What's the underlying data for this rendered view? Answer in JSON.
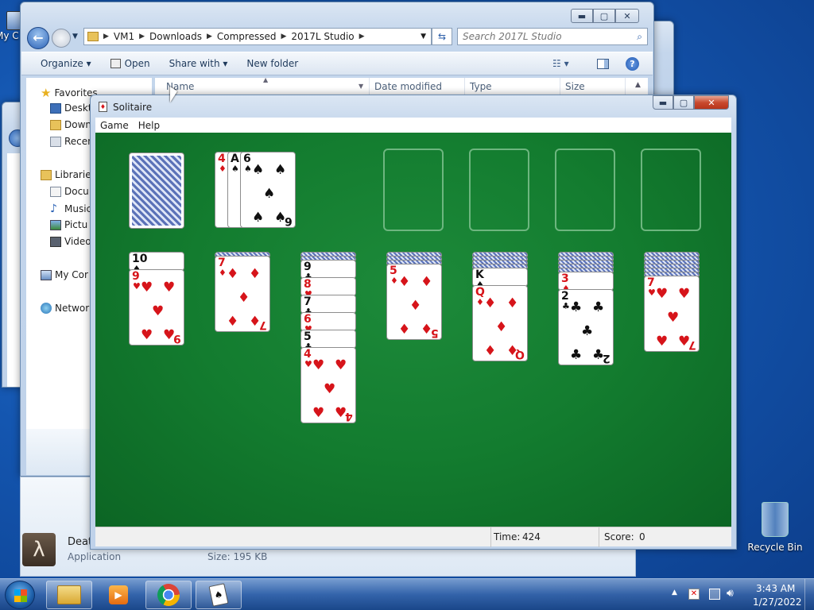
{
  "desktop": {
    "my_computer_label": "My C",
    "recycle_bin_label": "Recycle Bin"
  },
  "explorer": {
    "breadcrumbs": [
      "VM1",
      "Downloads",
      "Compressed",
      "2017L Studio"
    ],
    "search_placeholder": "Search 2017L Studio",
    "toolbar": {
      "organize": "Organize ▾",
      "open": "Open",
      "share_with": "Share with ▾",
      "new_folder": "New folder"
    },
    "nav": {
      "favorites": "Favorites",
      "desktop": "Deskt",
      "downloads": "Down",
      "recent": "Recen",
      "libraries": "Librarie",
      "documents": "Docu",
      "music": "Music",
      "pictures": "Pictu",
      "videos": "Video",
      "computer": "My Cor",
      "network": "Networ"
    },
    "columns": [
      "Name",
      "Date modified",
      "Type",
      "Size"
    ],
    "details": {
      "name": "Deat",
      "type": "Application",
      "size": "Size: 195 KB"
    }
  },
  "solitaire": {
    "title": "Solitaire",
    "menu": [
      "Game",
      "Help"
    ],
    "time_label": "Time:",
    "time_value": "424",
    "score_label": "Score:",
    "score_value": "0",
    "waste": [
      {
        "rank": "4",
        "suit": "♦",
        "color": "red"
      },
      {
        "rank": "A",
        "suit": "♠",
        "color": "black"
      },
      {
        "rank": "6",
        "suit": "♠",
        "color": "black"
      }
    ],
    "tableau": [
      {
        "face_down": 0,
        "cards": [
          {
            "rank": "10",
            "suit": "♠",
            "color": "black"
          },
          {
            "rank": "9",
            "suit": "♥",
            "color": "red"
          }
        ]
      },
      {
        "face_down": 1,
        "cards": [
          {
            "rank": "7",
            "suit": "♦",
            "color": "red"
          }
        ]
      },
      {
        "face_down": 2,
        "cards": [
          {
            "rank": "9",
            "suit": "♣",
            "color": "black"
          },
          {
            "rank": "8",
            "suit": "♥",
            "color": "red"
          },
          {
            "rank": "7",
            "suit": "♣",
            "color": "black"
          },
          {
            "rank": "6",
            "suit": "♥",
            "color": "red"
          },
          {
            "rank": "5",
            "suit": "♣",
            "color": "black"
          },
          {
            "rank": "4",
            "suit": "♥",
            "color": "red"
          }
        ]
      },
      {
        "face_down": 3,
        "cards": [
          {
            "rank": "5",
            "suit": "♦",
            "color": "red"
          }
        ]
      },
      {
        "face_down": 4,
        "cards": [
          {
            "rank": "K",
            "suit": "♠",
            "color": "black"
          },
          {
            "rank": "Q",
            "suit": "♦",
            "color": "red"
          }
        ]
      },
      {
        "face_down": 5,
        "cards": [
          {
            "rank": "3",
            "suit": "♦",
            "color": "red"
          },
          {
            "rank": "2",
            "suit": "♣",
            "color": "black"
          }
        ]
      },
      {
        "face_down": 6,
        "cards": [
          {
            "rank": "7",
            "suit": "♥",
            "color": "red"
          }
        ]
      }
    ]
  },
  "taskbar": {
    "clock_time": "3:43 AM",
    "clock_date": "1/27/2022"
  },
  "colors": {
    "felt": "#137c2f",
    "red_suit": "#d6141a",
    "black_suit": "#111111",
    "close_button": "#c94a2f"
  }
}
